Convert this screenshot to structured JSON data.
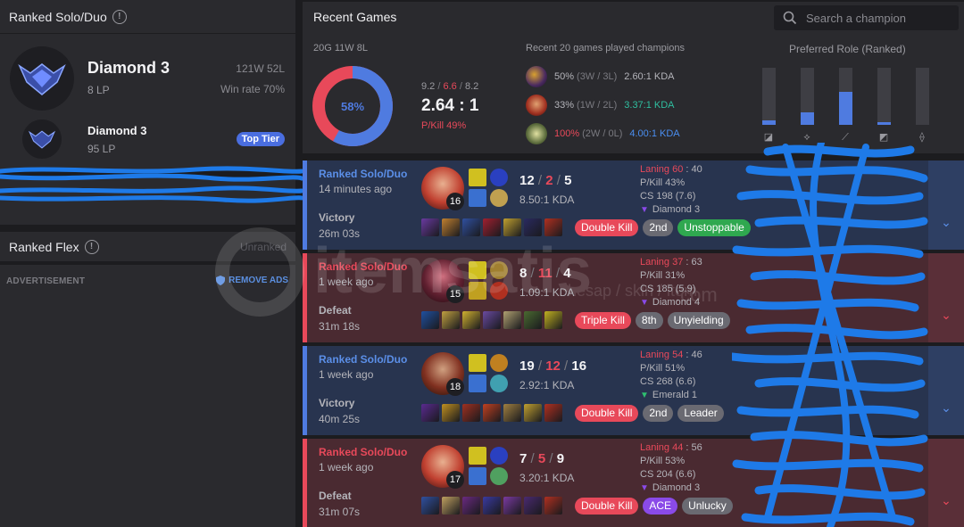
{
  "ranked_solo": {
    "title": "Ranked Solo/Duo",
    "tier": "Diamond 3",
    "lp": "8 LP",
    "record": "121W 52L",
    "win_rate": "Win rate 70%",
    "sub_tier": "Diamond 3",
    "sub_lp": "95 LP",
    "top_tier_badge": "Top Tier"
  },
  "ranked_flex": {
    "title": "Ranked Flex",
    "status": "Unranked"
  },
  "ads": {
    "label": "ADVERTISEMENT",
    "remove": "REMOVE ADS"
  },
  "recent": {
    "title": "Recent Games",
    "search_placeholder": "Search a champion",
    "summary": "20G 11W 8L",
    "winrate_pct": 58,
    "winrate_label": "58%",
    "kda_k": "9.2",
    "kda_d": "6.6",
    "kda_a": "8.2",
    "kda_ratio": "2.64 : 1",
    "pkill": "P/Kill 49%",
    "played_title": "Recent 20 games played champions",
    "played": [
      {
        "pct": "50%",
        "rec": "(3W / 3L)",
        "kda": "2.60:1 KDA",
        "pct_color": "#b4b4ba",
        "kda_color": "#b4b4ba"
      },
      {
        "pct": "33%",
        "rec": "(1W / 2L)",
        "kda": "3.37:1 KDA",
        "pct_color": "#b4b4ba",
        "kda_color": "#2fbfa0"
      },
      {
        "pct": "100%",
        "rec": "(2W / 0L)",
        "kda": "4.00:1 KDA",
        "pct_color": "#e8495a",
        "kda_color": "#4a8ef0"
      }
    ],
    "role_title": "Preferred Role (Ranked)",
    "roles": [
      {
        "name": "top-icon",
        "fraction": 0.08
      },
      {
        "name": "jungle-icon",
        "fraction": 0.22
      },
      {
        "name": "mid-icon",
        "fraction": 0.58
      },
      {
        "name": "bottom-icon",
        "fraction": 0.04
      },
      {
        "name": "support-icon",
        "fraction": 0.0
      }
    ]
  },
  "matches": [
    {
      "result_class": "win",
      "queue": "Ranked Solo/Duo",
      "ago": "14 minutes ago",
      "result": "Victory",
      "duration": "26m 03s",
      "level": "16",
      "k": "12",
      "d": "2",
      "a": "5",
      "kda": "8.50:1 KDA",
      "laning_label": "Laning 60",
      "laning_rest": " : 40",
      "pkill": "P/Kill 43%",
      "cs": "CS 198 (7.6)",
      "rank": "Diamond 3",
      "rank_color": "#8a4ae8",
      "tags": [
        {
          "text": "Double Kill",
          "cls": "red"
        },
        {
          "text": "2nd",
          "cls": "gray"
        },
        {
          "text": "Unstoppable",
          "cls": "green"
        }
      ]
    },
    {
      "result_class": "loss",
      "queue": "Ranked Solo/Duo",
      "ago": "1 week ago",
      "result": "Defeat",
      "duration": "31m 18s",
      "level": "15",
      "k": "8",
      "d": "11",
      "a": "4",
      "kda": "1.09:1 KDA",
      "laning_label": "Laning 37",
      "laning_rest": " : 63",
      "pkill": "P/Kill 31%",
      "cs": "CS 185 (5.9)",
      "rank": "Diamond 4",
      "rank_color": "#8a4ae8",
      "tags": [
        {
          "text": "Triple Kill",
          "cls": "red"
        },
        {
          "text": "8th",
          "cls": "gray"
        },
        {
          "text": "Unyielding",
          "cls": "gray"
        }
      ]
    },
    {
      "result_class": "win",
      "queue": "Ranked Solo/Duo",
      "ago": "1 week ago",
      "result": "Victory",
      "duration": "40m 25s",
      "level": "18",
      "k": "19",
      "d": "12",
      "a": "16",
      "kda": "2.92:1 KDA",
      "laning_label": "Laning 54",
      "laning_rest": " : 46",
      "pkill": "P/Kill 51%",
      "cs": "CS 268 (6.6)",
      "rank": "Emerald 1",
      "rank_color": "#2fbf70",
      "tags": [
        {
          "text": "Double Kill",
          "cls": "red"
        },
        {
          "text": "2nd",
          "cls": "gray"
        },
        {
          "text": "Leader",
          "cls": "gray"
        }
      ]
    },
    {
      "result_class": "loss",
      "queue": "Ranked Solo/Duo",
      "ago": "1 week ago",
      "result": "Defeat",
      "duration": "31m 07s",
      "level": "17",
      "k": "7",
      "d": "5",
      "a": "9",
      "kda": "3.20:1 KDA",
      "laning_label": "Laning 44",
      "laning_rest": " : 56",
      "pkill": "P/Kill 53%",
      "cs": "CS 204 (6.6)",
      "rank": "Diamond 3",
      "rank_color": "#8a4ae8",
      "tags": [
        {
          "text": "Double Kill",
          "cls": "red"
        },
        {
          "text": "ACE",
          "cls": "purple"
        },
        {
          "text": "Unlucky",
          "cls": "gray"
        }
      ]
    }
  ],
  "colors": {
    "win": "#4f7be0",
    "loss": "#e8495a",
    "panel": "#2a2a2e",
    "bg": "#1c1c1f"
  },
  "watermark": "itemsatis",
  "watermark_sub": "hesap / skin / item",
  "watermark_tld": ".com"
}
